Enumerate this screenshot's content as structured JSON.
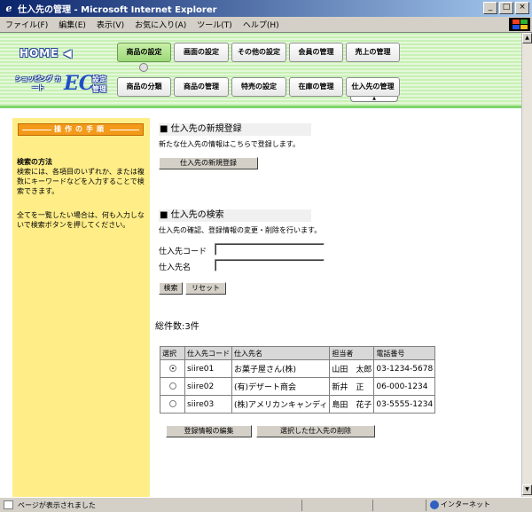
{
  "window": {
    "title": "仕入先の管理 - Microsoft Internet Explorer"
  },
  "menubar": [
    "ファイル(F)",
    "編集(E)",
    "表示(V)",
    "お気に入り(A)",
    "ツール(T)",
    "ヘルプ(H)"
  ],
  "header": {
    "home_label": "HOME ◀",
    "logo_shop": "ショッピング カート",
    "logo_ec": "EC",
    "logo_setting": "設定 管理",
    "top_nav": [
      "商品の設定",
      "画面の設定",
      "その他の設定",
      "会員の管理",
      "売上の管理"
    ],
    "sub_nav": [
      "商品の分類",
      "商品の管理",
      "特売の設定",
      "在庫の管理",
      "仕入先の管理"
    ],
    "active_top": "商品の設定",
    "active_sub": "仕入先の管理"
  },
  "sidebar": {
    "heading": "操作の手順",
    "search_title": "検索の方法",
    "search_text": "検索には、各項目のいずれか、または複数にキーワードなどを入力することで検索できます。",
    "list_text": "全てを一覧したい場合は、何も入力しないで検索ボタンを押してください。"
  },
  "register": {
    "title": "■ 仕入先の新規登録",
    "desc": "新たな仕入先の情報はこちらで登録します。",
    "button": "仕入先の新規登録"
  },
  "search": {
    "title": "■ 仕入先の検索",
    "desc": "仕入先の確認、登録情報の変更・削除を行います。",
    "code_label": "仕入先コード",
    "name_label": "仕入先名",
    "code_value": "",
    "name_value": "",
    "search_button": "検索",
    "reset_button": "リセット"
  },
  "results": {
    "count": "総件数:3件",
    "headers": [
      "選択",
      "仕入先コード",
      "仕入先名",
      "担当者",
      "電話番号"
    ],
    "rows": [
      {
        "selected": true,
        "code": "siire01",
        "name": "お菓子屋さん(株)",
        "contact": "山田　太郎",
        "phone": "03-1234-5678"
      },
      {
        "selected": false,
        "code": "siire02",
        "name": "(有)デザート商会",
        "contact": "新井　正",
        "phone": "06-000-1234"
      },
      {
        "selected": false,
        "code": "siire03",
        "name": "(株)アメリカンキャンディ",
        "contact": "島田　花子",
        "phone": "03-5555-1234"
      }
    ],
    "edit_button": "登録情報の編集",
    "delete_button": "選択した仕入先の削除"
  },
  "statusbar": {
    "text": "ページが表示されました",
    "zone": "インターネット"
  },
  "colors": {
    "accent_green": "#9ed87a",
    "sidebar_yellow": "#ffee88",
    "heading_orange": "#f39a1a"
  }
}
